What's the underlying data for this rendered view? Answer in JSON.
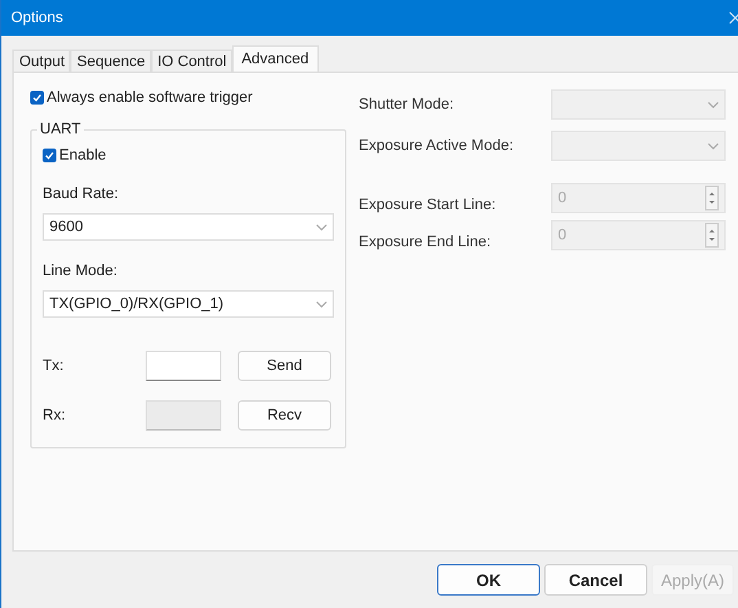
{
  "window": {
    "title": "Options"
  },
  "tabs": [
    {
      "label": "Output",
      "selected": false
    },
    {
      "label": "Sequence",
      "selected": false
    },
    {
      "label": "IO Control",
      "selected": false
    },
    {
      "label": "Advanced",
      "selected": true
    }
  ],
  "software_trigger": {
    "label": "Always enable software trigger",
    "checked": true
  },
  "uart": {
    "title": "UART",
    "enable": {
      "label": "Enable",
      "checked": true
    },
    "fields": [
      {
        "label": "Baud Rate:",
        "value": "9600"
      },
      {
        "label": "Line Mode:",
        "value": "TX(GPIO_0)/RX(GPIO_1)"
      }
    ],
    "io": [
      {
        "label": "Tx:",
        "disabled": false,
        "button": "Send"
      },
      {
        "label": "Rx:",
        "disabled": true,
        "button": "Recv"
      }
    ]
  },
  "settings": [
    {
      "kind": "select",
      "label": "Shutter Mode:",
      "disabled": true
    },
    {
      "kind": "select",
      "label": "Exposure Active Mode:",
      "disabled": true
    },
    {
      "kind": "spin",
      "label": "Exposure Start Line:",
      "value": "0",
      "disabled": true
    },
    {
      "kind": "spin",
      "label": "Exposure End Line:",
      "value": "0",
      "disabled": true
    }
  ],
  "buttons": [
    {
      "label": "OK",
      "default": true,
      "disabled": false
    },
    {
      "label": "Cancel",
      "default": false,
      "disabled": false
    },
    {
      "label": "Apply(A)",
      "default": false,
      "disabled": true
    }
  ]
}
